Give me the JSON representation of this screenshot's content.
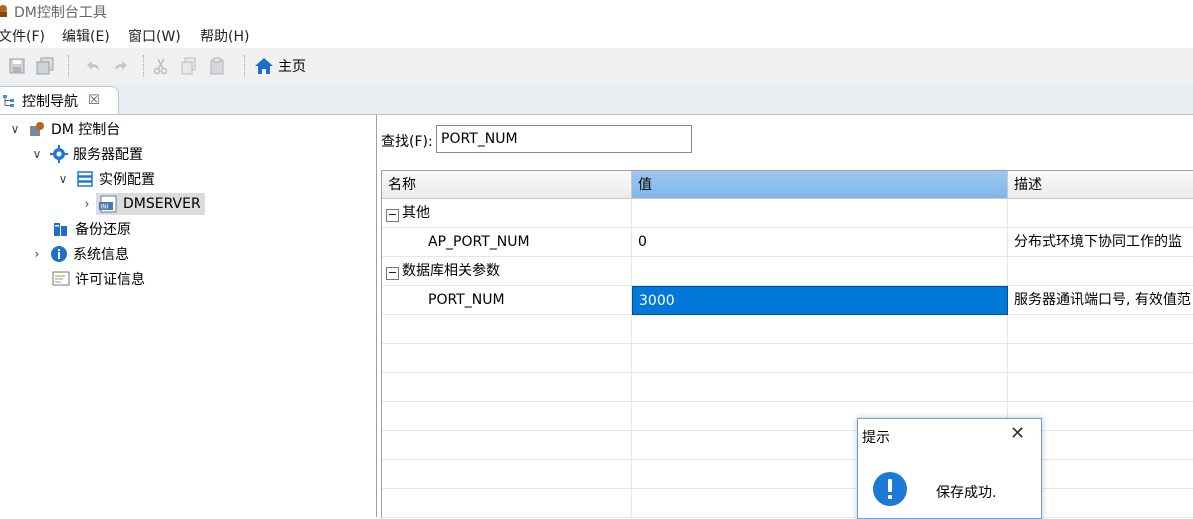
{
  "window": {
    "title": "DM控制台工具"
  },
  "menu": [
    "文件(F)",
    "编辑(E)",
    "窗口(W)",
    "帮助(H)"
  ],
  "toolbar": {
    "home_label": "主页"
  },
  "tabs": {
    "nav_label": "控制导航",
    "close_glyph": "☒"
  },
  "tree": {
    "root": "DM 控制台",
    "server_config": "服务器配置",
    "instance_config": "实例配置",
    "server_name": "DMSERVER",
    "backup": "备份还原",
    "sysinfo": "系统信息",
    "license": "许可证信息"
  },
  "search": {
    "label": "查找(F):",
    "value": "PORT_NUM"
  },
  "grid": {
    "headers": [
      "名称",
      "值",
      "描述"
    ],
    "group1": "其他",
    "row1": {
      "name": "AP_PORT_NUM",
      "value": "0",
      "desc": "分布式环境下协同工作的监"
    },
    "group2": "数据库相关参数",
    "row2": {
      "name": "PORT_NUM",
      "value": "3000",
      "desc": "服务器通讯端口号, 有效值范"
    }
  },
  "dialog": {
    "title": "提示",
    "message": "保存成功.",
    "close_glyph": "✕"
  },
  "colors": {
    "selection": "#0078d7",
    "header_active": "#7fb6e8",
    "info_icon": "#1e78d7"
  }
}
